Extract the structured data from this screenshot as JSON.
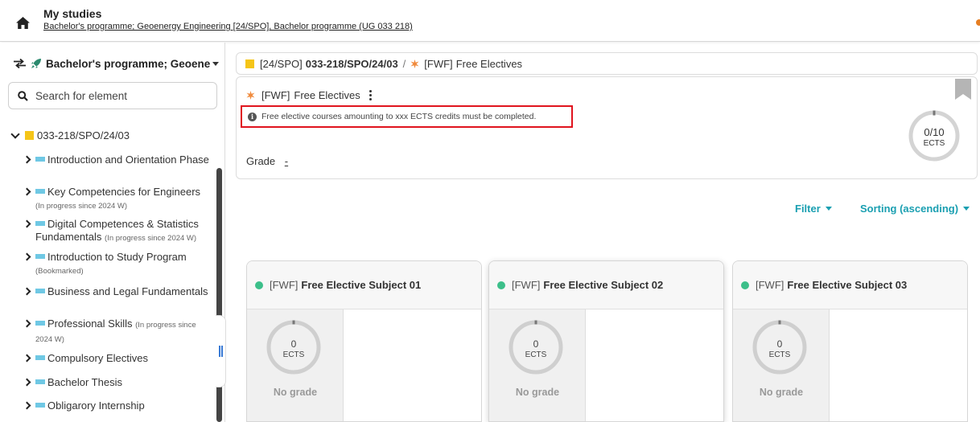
{
  "header": {
    "title": "My studies",
    "subtitle": "Bachelor's programme; Geoenergy Engineering [24/SPO], Bachelor programme (UG 033 218)"
  },
  "sidebar": {
    "programme_switch": "Bachelor's programme; Geoene",
    "search_placeholder": "Search for element",
    "root": "033-218/SPO/24/03",
    "items": [
      {
        "label": "Introduction and Orientation Phase",
        "note": ""
      },
      {
        "label": "Key Competencies for Engineers",
        "note": "(In progress since 2024 W)"
      },
      {
        "label": "Digital Competences & Statistics Fundamentals",
        "note": "(In progress since 2024 W)"
      },
      {
        "label": "Introduction to Study Program",
        "note": "(Bookmarked)"
      },
      {
        "label": "Business and Legal Fundamentals",
        "note": ""
      },
      {
        "label": "Professional Skills",
        "note": "(In progress since 2024 W)"
      },
      {
        "label": "Compulsory Electives",
        "note": ""
      },
      {
        "label": "Bachelor Thesis",
        "note": ""
      },
      {
        "label": "Obligarory Internship",
        "note": ""
      }
    ]
  },
  "breadcrumb": {
    "code": "[24/SPO]",
    "strong": "033-218/SPO/24/03",
    "separator": "/",
    "module_code": "[FWF]",
    "module_name": "Free Electives"
  },
  "module": {
    "code": "[FWF]",
    "name": "Free Electives",
    "info": "Free elective courses amounting to xxx ECTS credits must be completed.",
    "grade_label": "Grade",
    "grade_value": "-",
    "ects_progress": "0/10",
    "ects_unit": "ECTS"
  },
  "controls": {
    "filter": "Filter",
    "sorting": "Sorting (ascending)"
  },
  "subjects": [
    {
      "code": "[FWF]",
      "name": "Free Elective Subject 01",
      "ects": "0",
      "unit": "ECTS",
      "grade": "No grade"
    },
    {
      "code": "[FWF]",
      "name": "Free Elective Subject 02",
      "ects": "0",
      "unit": "ECTS",
      "grade": "No grade"
    },
    {
      "code": "[FWF]",
      "name": "Free Elective Subject 03",
      "ects": "0",
      "unit": "ECTS",
      "grade": "No grade"
    }
  ],
  "colors": {
    "accent": "#1a9fb1",
    "status_dot": "#3cbf8a",
    "folder_yellow": "#f5c518",
    "node_blue": "#6fc8e4",
    "module_orange": "#f08a3c",
    "highlight_red": "#e0141e"
  },
  "icons": [
    "home-icon",
    "swap-icon",
    "rocket-icon",
    "search-icon",
    "info-icon",
    "bookmark-icon",
    "more-vertical-icon"
  ]
}
